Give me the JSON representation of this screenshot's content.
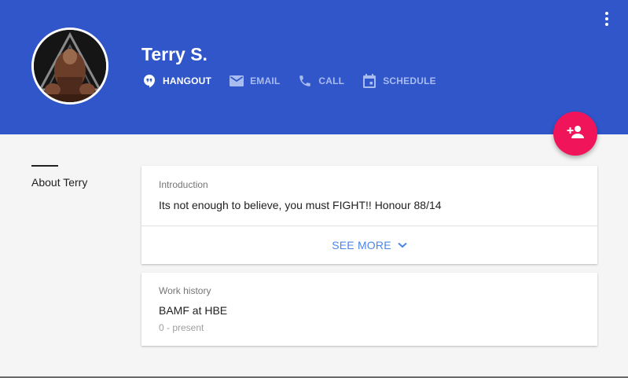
{
  "profile": {
    "name": "Terry S."
  },
  "actions": [
    {
      "label": "HANGOUT",
      "icon": "hangout-icon",
      "active": true
    },
    {
      "label": "EMAIL",
      "icon": "email-icon",
      "active": false
    },
    {
      "label": "CALL",
      "icon": "phone-icon",
      "active": false
    },
    {
      "label": "SCHEDULE",
      "icon": "calendar-icon",
      "active": false
    }
  ],
  "sidebar": {
    "label": "About Terry"
  },
  "intro": {
    "title": "Introduction",
    "text": "Its not enough to believe, you must FIGHT!! Honour 88/14",
    "see_more": "SEE MORE"
  },
  "work": {
    "title": "Work history",
    "job": "BAMF at HBE",
    "period": "0 - present"
  },
  "colors": {
    "header": "#3056c9",
    "fab": "#f0145a",
    "link": "#4a86e8"
  }
}
